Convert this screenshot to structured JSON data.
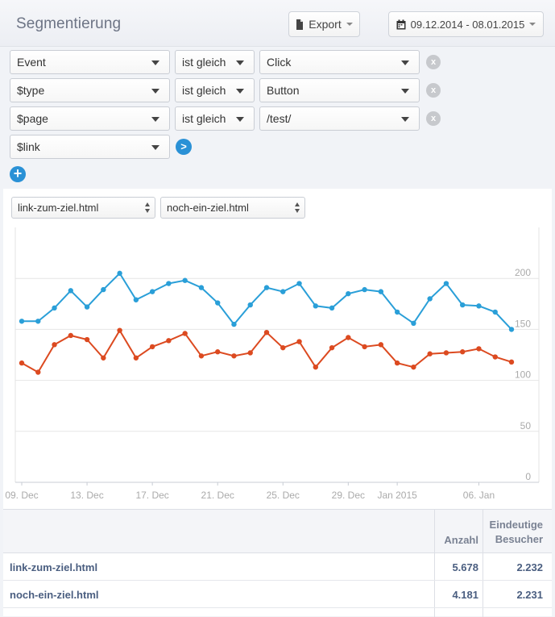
{
  "header": {
    "title": "Segmentierung",
    "export_label": "Export",
    "date_range": "09.12.2014 - 08.01.2015"
  },
  "filters": [
    {
      "property": "Event",
      "operator": "ist gleich",
      "value": "Click"
    },
    {
      "property": "$type",
      "operator": "ist gleich",
      "value": "Button"
    },
    {
      "property": "$page",
      "operator": "ist gleich",
      "value": "/test/"
    }
  ],
  "breakdown": {
    "property": "$link"
  },
  "icons": {
    "remove": "close-icon",
    "apply": "chevron-right-icon",
    "add": "plus-icon",
    "export": "document-icon",
    "date": "calendar-icon"
  },
  "compare": {
    "first": "link-zum-ziel.html",
    "second": "noch-ein-ziel.html"
  },
  "chart_data": {
    "type": "line",
    "x": [
      "09. Dec",
      "10. Dec",
      "11. Dec",
      "12. Dec",
      "13. Dec",
      "14. Dec",
      "15. Dec",
      "16. Dec",
      "17. Dec",
      "18. Dec",
      "19. Dec",
      "20. Dec",
      "21. Dec",
      "22. Dec",
      "23. Dec",
      "24. Dec",
      "25. Dec",
      "26. Dec",
      "27. Dec",
      "28. Dec",
      "29. Dec",
      "30. Dec",
      "31. Dec",
      "01. Jan",
      "02. Jan",
      "03. Jan",
      "04. Jan",
      "05. Jan",
      "06. Jan",
      "07. Jan",
      "08. Jan"
    ],
    "x_ticks": [
      "09. Dec",
      "13. Dec",
      "17. Dec",
      "21. Dec",
      "25. Dec",
      "29. Dec",
      "Jan 2015",
      "06. Jan"
    ],
    "y_ticks": [
      0,
      50,
      100,
      150,
      200
    ],
    "ylim": [
      0,
      250
    ],
    "grid": true,
    "series": [
      {
        "name": "link-zum-ziel.html",
        "color": "#2a9fd8",
        "values": [
          158,
          158,
          171,
          188,
          172,
          189,
          205,
          179,
          187,
          195,
          198,
          191,
          176,
          155,
          174,
          191,
          187,
          195,
          173,
          171,
          185,
          189,
          187,
          167,
          156,
          180,
          195,
          174,
          173,
          167,
          150
        ]
      },
      {
        "name": "noch-ein-ziel.html",
        "color": "#dc4a20",
        "values": [
          117,
          108,
          135,
          144,
          140,
          122,
          149,
          122,
          133,
          139,
          146,
          124,
          128,
          124,
          127,
          147,
          132,
          138,
          113,
          132,
          142,
          133,
          135,
          117,
          113,
          126,
          127,
          128,
          131,
          123,
          118
        ]
      }
    ]
  },
  "table": {
    "columns": [
      "Anzahl",
      "Eindeutige",
      "Besucher"
    ],
    "rows": [
      {
        "name": "link-zum-ziel.html",
        "count": "5.678",
        "unique": "2.232"
      },
      {
        "name": "noch-ein-ziel.html",
        "count": "4.181",
        "unique": "2.231"
      }
    ]
  }
}
